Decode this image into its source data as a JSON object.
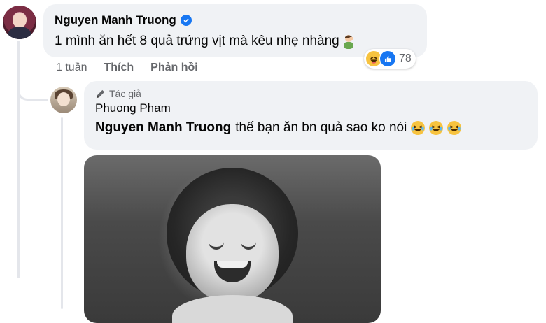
{
  "comment": {
    "author": "Nguyen Manh Truong",
    "verified": true,
    "text": "1 mình ăn hết 8 quả trứng vịt mà kêu nhẹ nhàng",
    "trailing_emoji": "man-facepalming",
    "reactions": {
      "icons": [
        "haha",
        "like"
      ],
      "count": "78"
    },
    "actions": {
      "time": "1 tuần",
      "like": "Thích",
      "reply": "Phản hồi"
    }
  },
  "reply": {
    "badge": "Tác giả",
    "author": "Phuong Pham",
    "mention": "Nguyen Manh Truong",
    "text": "thế bạn ăn bn quả sao ko nói",
    "emojis": [
      "laughing-crying",
      "laughing-crying",
      "laughing-crying"
    ],
    "media": "black-and-white-laughing-child-gif"
  },
  "colors": {
    "bubble": "#f0f2f5",
    "accent": "#1877f2",
    "muted": "#65676b",
    "haha": "#f7c33f"
  }
}
